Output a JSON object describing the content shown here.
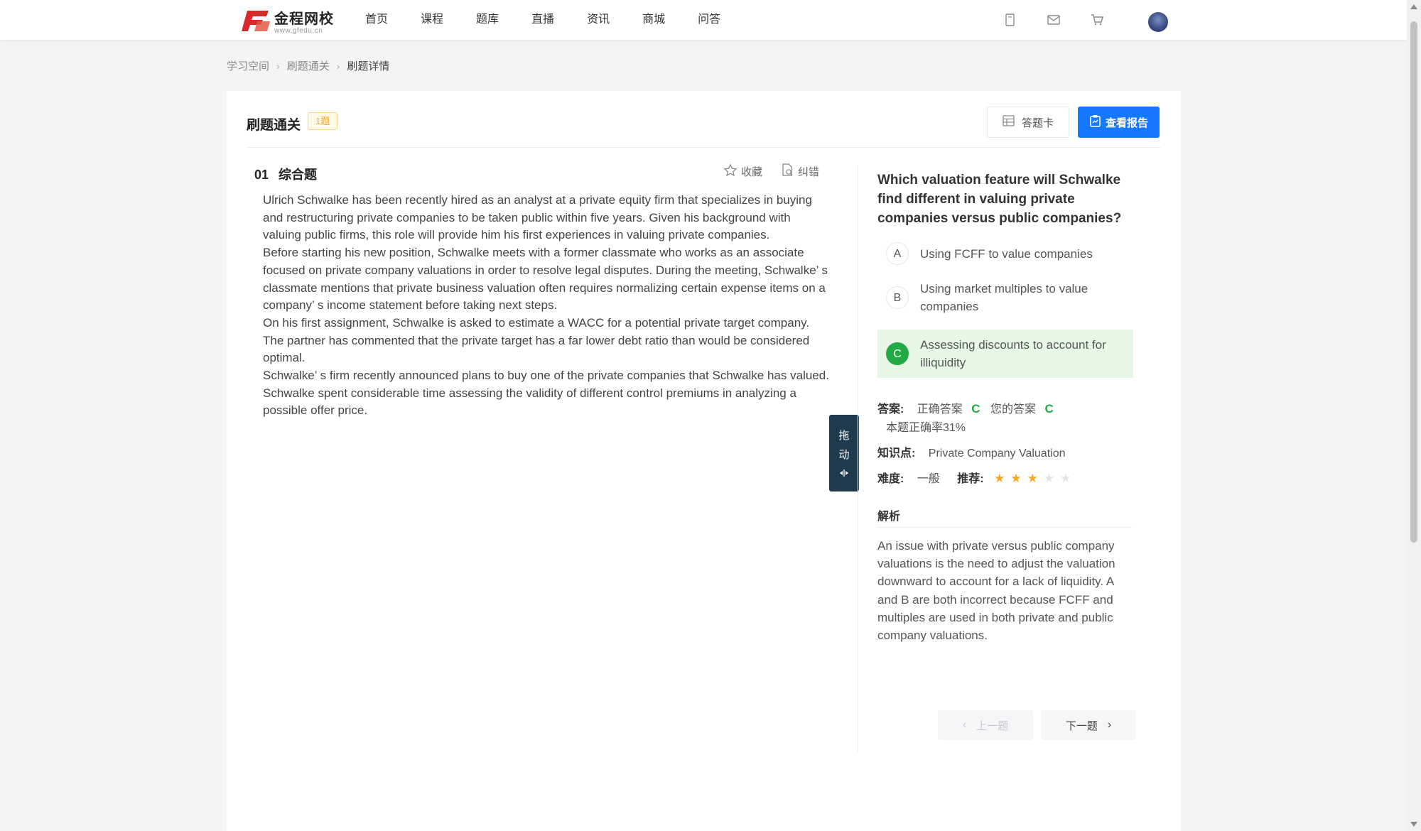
{
  "header": {
    "logo_name": "金程网校",
    "logo_url": "www.gfedu.cn",
    "nav": [
      "首页",
      "课程",
      "题库",
      "直播",
      "资讯",
      "商城",
      "问答"
    ],
    "icons": [
      "bookmark-icon",
      "mail-icon",
      "cart-icon"
    ]
  },
  "breadcrumb": {
    "items": [
      "学习空间",
      "刷题通关"
    ],
    "current": "刷题详情"
  },
  "toolbar": {
    "title": "刷题通关",
    "count_badge": "1题",
    "answer_card_label": "答题卡",
    "report_label": "查看报告"
  },
  "question": {
    "number": "01",
    "type": "综合题",
    "favorite_label": "收藏",
    "report_error_label": "纠错",
    "stem": [
      "Ulrich Schwalke has been recently hired as an analyst at a private equity firm that specializes in buying and restructuring private companies to be taken public within five years. Given his background with valuing public firms, this role will provide him his first experiences in valuing private companies.",
      "Before starting his new position, Schwalke meets with a former classmate who works as an associate focused on private company valuations in order to resolve legal disputes. During the meeting, Schwalke’ s classmate mentions that private business valuation often requires normalizing certain expense items on a company’ s income statement before taking next steps.",
      "On his first assignment, Schwalke is asked to estimate a WACC for a potential private target company. The partner has commented that the private target has a far lower debt ratio than would be considered optimal.",
      "Schwalke’ s firm recently announced plans to buy one of the private companies that Schwalke has valued. Schwalke spent considerable time assessing the validity of different control premiums in analyzing a possible offer price."
    ],
    "drag_chars": [
      "拖",
      "动"
    ]
  },
  "sub_question": {
    "text": "Which valuation feature will Schwalke find different in valuing private companies versus public companies?",
    "options": [
      {
        "letter": "A",
        "text": "Using FCFF to value companies"
      },
      {
        "letter": "B",
        "text": "Using market multiples to value companies"
      },
      {
        "letter": "C",
        "text": "Assessing discounts to account for illiquidity"
      }
    ],
    "correct_option": "C"
  },
  "result": {
    "answer_label": "答案:",
    "correct_label": "正确答案",
    "correct_value": "C",
    "yours_label": "您的答案",
    "yours_value": "C",
    "accuracy": "本题正确率31%",
    "knowledge_label": "知识点:",
    "knowledge_value": "Private Company Valuation",
    "difficulty_label": "难度:",
    "difficulty_value": "一般",
    "recommend_label": "推荐:",
    "recommend_stars": 3,
    "recommend_max": 5
  },
  "analysis": {
    "title": "解析",
    "text": "An issue with private versus public company valuations is the need to adjust the valuation downward to account for a lack of liquidity. A and B are both incorrect because FCFF and multiples are used in both private and public company valuations."
  },
  "pager": {
    "prev_label": "上一题",
    "next_label": "下一题"
  },
  "colors": {
    "primary": "#1677ff",
    "correct": "#22aa44",
    "star": "#f5a623",
    "badge": "#e8a93b"
  }
}
